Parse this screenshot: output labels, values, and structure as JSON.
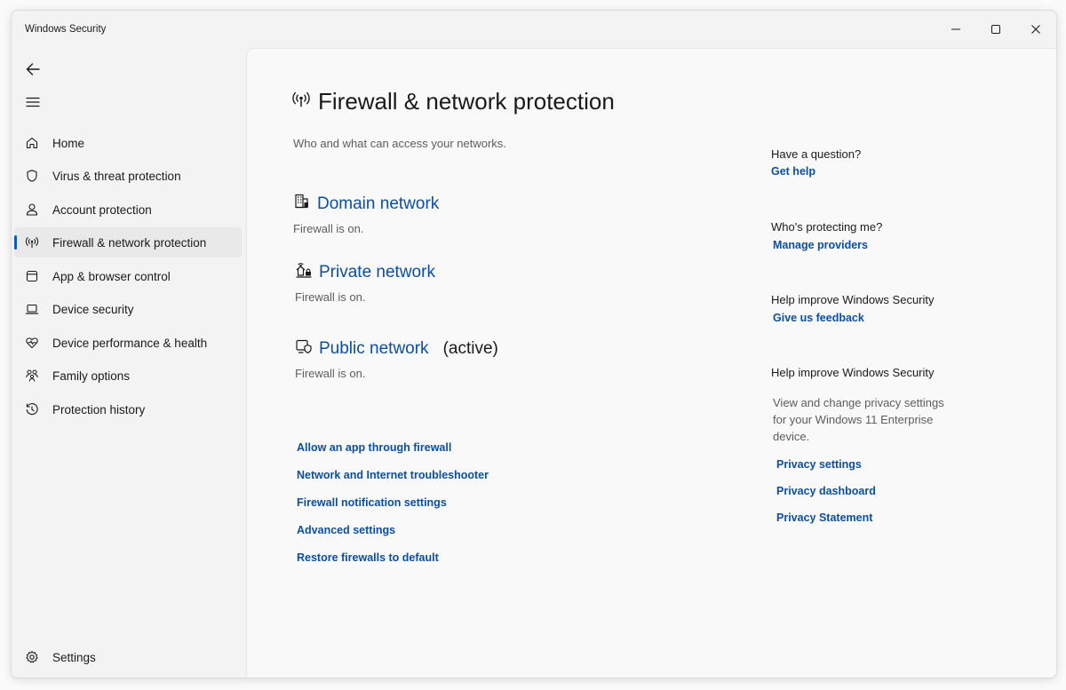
{
  "window": {
    "title": "Windows Security"
  },
  "sidebar": {
    "items": [
      {
        "label": "Home",
        "icon": "home-icon"
      },
      {
        "label": "Virus & threat protection",
        "icon": "shield-icon"
      },
      {
        "label": "Account protection",
        "icon": "person-icon"
      },
      {
        "label": "Firewall & network protection",
        "icon": "antenna-icon",
        "selected": true
      },
      {
        "label": "App & browser control",
        "icon": "app-window-icon"
      },
      {
        "label": "Device security",
        "icon": "laptop-icon"
      },
      {
        "label": "Device performance & health",
        "icon": "heart-pulse-icon"
      },
      {
        "label": "Family options",
        "icon": "family-icon"
      },
      {
        "label": "Protection history",
        "icon": "history-icon"
      }
    ],
    "settings_label": "Settings"
  },
  "main": {
    "title": "Firewall & network protection",
    "subtitle": "Who and what can access your networks.",
    "networks": [
      {
        "name": "Domain network",
        "status": "Firewall is on.",
        "active_label": ""
      },
      {
        "name": "Private network",
        "status": "Firewall is on.",
        "active_label": ""
      },
      {
        "name": "Public network",
        "status": "Firewall is on.",
        "active_label": "(active)"
      }
    ],
    "links": [
      "Allow an app through firewall",
      "Network and Internet troubleshooter",
      "Firewall notification settings",
      "Advanced settings",
      "Restore firewalls to default"
    ]
  },
  "aside": {
    "question_title": "Have a question?",
    "question_link": "Get help",
    "protecting_title": "Who's protecting me?",
    "protecting_link": "Manage providers",
    "feedback_title": "Help improve Windows Security",
    "feedback_link": "Give us feedback",
    "privacy_title": "Help improve Windows Security",
    "privacy_desc": "View and change privacy settings for your Windows 11 Enterprise device.",
    "privacy_links": [
      "Privacy settings",
      "Privacy dashboard",
      "Privacy Statement"
    ]
  },
  "colors": {
    "accent": "#0f5cc0",
    "link": "#0b4fa3"
  }
}
